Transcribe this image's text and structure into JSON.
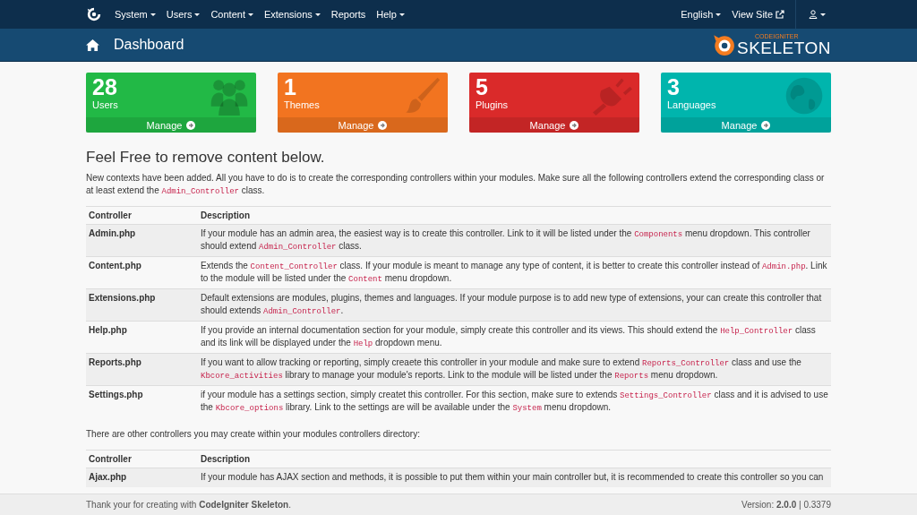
{
  "nav": {
    "menus": [
      {
        "label": "System",
        "caret": true
      },
      {
        "label": "Users",
        "caret": true
      },
      {
        "label": "Content",
        "caret": true
      },
      {
        "label": "Extensions",
        "caret": true
      },
      {
        "label": "Reports",
        "caret": false
      },
      {
        "label": "Help",
        "caret": true
      }
    ],
    "right": [
      {
        "label": "English",
        "kind": "dropdown"
      },
      {
        "label": "View Site",
        "kind": "external"
      },
      {
        "kind": "user"
      }
    ]
  },
  "header": {
    "title": "Dashboard",
    "logo_small": "CODEIGNITER",
    "logo_big": "SKELETON"
  },
  "stats": [
    {
      "count": "28",
      "label": "Users",
      "action": "Manage",
      "color": "#22b946"
    },
    {
      "count": "1",
      "label": "Themes",
      "action": "Manage",
      "color": "#f27420"
    },
    {
      "count": "5",
      "label": "Plugins",
      "action": "Manage",
      "color": "#da2a2a"
    },
    {
      "count": "3",
      "label": "Languages",
      "action": "Manage",
      "color": "#00b5ad"
    }
  ],
  "heading": "Feel Free to remove content below.",
  "intro": [
    {
      "text": "New contexts have been added. All you have to do is to create the corresponding controllers within your modules. Make sure all the following controllers extend the corresponding class or at least extend the "
    },
    {
      "text": "Admin_Controller",
      "kind": "code"
    },
    {
      "text": " class."
    }
  ],
  "table": {
    "columns": [
      "Controller",
      "Description"
    ],
    "rows": [
      {
        "name": "Admin.php",
        "desc": [
          {
            "text": "If your module has an admin area, the easiest way is to create this controller. Link to it will be listed under the "
          },
          {
            "text": "Components",
            "kind": "code"
          },
          {
            "text": " menu dropdown. This controller should extend "
          },
          {
            "text": "Admin_Controller",
            "kind": "code"
          },
          {
            "text": " class."
          }
        ]
      },
      {
        "name": "Content.php",
        "desc": [
          {
            "text": "Extends the "
          },
          {
            "text": "Content_Controller",
            "kind": "code"
          },
          {
            "text": " class. If your module is meant to manage any type of content, it is better to create this controller instead of "
          },
          {
            "text": "Admin.php",
            "kind": "code"
          },
          {
            "text": ". Link to the module will be listed under the "
          },
          {
            "text": "Content",
            "kind": "code"
          },
          {
            "text": " menu dropdown."
          }
        ]
      },
      {
        "name": "Extensions.php",
        "desc": [
          {
            "text": "Default extensions are modules, plugins, themes and languages. If your module purpose is to add new type of extensions, your can create this controller that should extends "
          },
          {
            "text": "Admin_Controller",
            "kind": "code"
          },
          {
            "text": "."
          }
        ]
      },
      {
        "name": "Help.php",
        "desc": [
          {
            "text": "If you provide an internal documentation section for your module, simply create this controller and its views. This should extend the "
          },
          {
            "text": "Help_Controller",
            "kind": "code"
          },
          {
            "text": " class and its link will be displayed under the "
          },
          {
            "text": "Help",
            "kind": "code"
          },
          {
            "text": " dropdown menu."
          }
        ]
      },
      {
        "name": "Reports.php",
        "desc": [
          {
            "text": "If you want to allow tracking or reporting, simply creaete this controller in your module and make sure to extend "
          },
          {
            "text": "Reports_Controller",
            "kind": "code"
          },
          {
            "text": " class and use the "
          },
          {
            "text": "Kbcore_activities",
            "kind": "code"
          },
          {
            "text": " library to manage your module's reports. Link to the module will be listed under the "
          },
          {
            "text": "Reports",
            "kind": "code"
          },
          {
            "text": " menu dropdown."
          }
        ]
      },
      {
        "name": "Settings.php",
        "desc": [
          {
            "text": "if your module has a settings section, simply createt this controller. For this section, make sure to extends "
          },
          {
            "text": "Settings_Controller",
            "kind": "code"
          },
          {
            "text": " class and it is advised to use the "
          },
          {
            "text": "Kbcore_options",
            "kind": "code"
          },
          {
            "text": " library. Link to the settings are will be available under the "
          },
          {
            "text": "System",
            "kind": "code"
          },
          {
            "text": " menu dropdown."
          }
        ]
      }
    ]
  },
  "paragraph2": "There are other controllers you may create within your modules controllers directory:",
  "table2": {
    "columns": [
      "Controller",
      "Description"
    ],
    "rows": [
      {
        "name": "Ajax.php",
        "desc": [
          {
            "text": "If your module has AJAX section and methods, it is possible to put them within your main controller but, it is recommended to create this controller so you can"
          }
        ]
      }
    ]
  },
  "footer": {
    "text": "Thank your for creating with **CodeIgniter Skeleton**.",
    "version_label": "Version:",
    "version": "2.0.0",
    "separator": "|",
    "time": "0.3379"
  }
}
